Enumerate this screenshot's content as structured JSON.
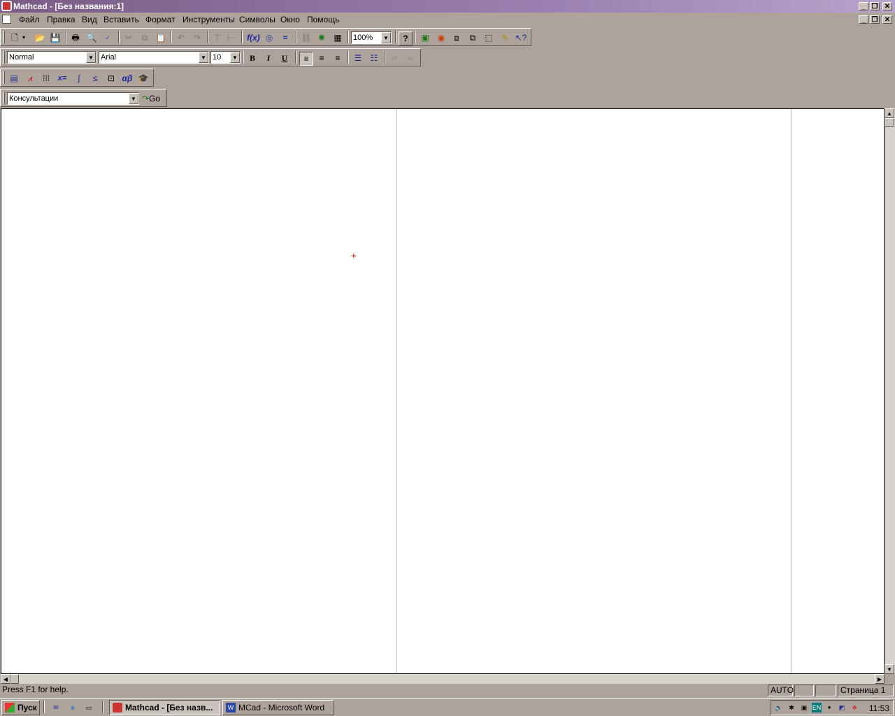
{
  "window": {
    "title": "Mathcad - [Без названия:1]",
    "controls": [
      "_",
      "❐",
      "✕"
    ]
  },
  "menu": {
    "items": [
      "Файл",
      "Правка",
      "Вид",
      "Вставить",
      "Формат",
      "Инструменты",
      "Символы",
      "Окно",
      "Помощь"
    ]
  },
  "toolbar": {
    "zoom": "100%",
    "style": "Normal",
    "font": "Arial",
    "size": "10",
    "bold": "B",
    "italic": "I",
    "underline": "U",
    "resources": "Консультации",
    "go": "Go"
  },
  "math_toolbar": {
    "eval": "x=",
    "greek": "αβ"
  },
  "status": {
    "help": "Press F1 for help.",
    "mode": "AUTO",
    "page": "Страница 1"
  },
  "taskbar": {
    "start": "Пуск",
    "tasks": [
      "Mathcad - [Без назв...",
      "MCad - Microsoft Word"
    ],
    "tray_lang": "EN",
    "clock": "11:53"
  }
}
